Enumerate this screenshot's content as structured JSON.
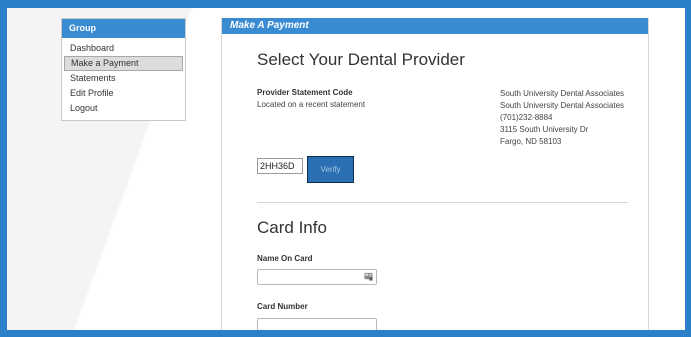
{
  "sidebar": {
    "header": "Group",
    "items": [
      {
        "label": "Dashboard"
      },
      {
        "label": "Make a Payment"
      },
      {
        "label": "Statements"
      },
      {
        "label": "Edit Profile"
      },
      {
        "label": "Logout"
      }
    ],
    "active_index": 1
  },
  "main": {
    "header": "Make A Payment",
    "provider_section": {
      "title": "Select Your Dental Provider",
      "code_label": "Provider Statement Code",
      "code_hint": "Located on a recent statement",
      "provider_name_1": "South University Dental Associates",
      "provider_name_2": "South University Dental Associates",
      "phone": "(701)232-8884",
      "address_line1": "3115 South University Dr",
      "address_line2": "Fargo, ND 58103",
      "code_value": "2HH36D",
      "verify_label": "Verify"
    },
    "card_section": {
      "title": "Card Info",
      "name_label": "Name On Card",
      "name_value": "",
      "number_label": "Card Number",
      "number_value": ""
    }
  },
  "colors": {
    "frame": "#2c7fc9",
    "header": "#3b8bd2",
    "button": "#2a6fb2"
  },
  "icons": {
    "name_field_icon": "contact-card-icon"
  }
}
